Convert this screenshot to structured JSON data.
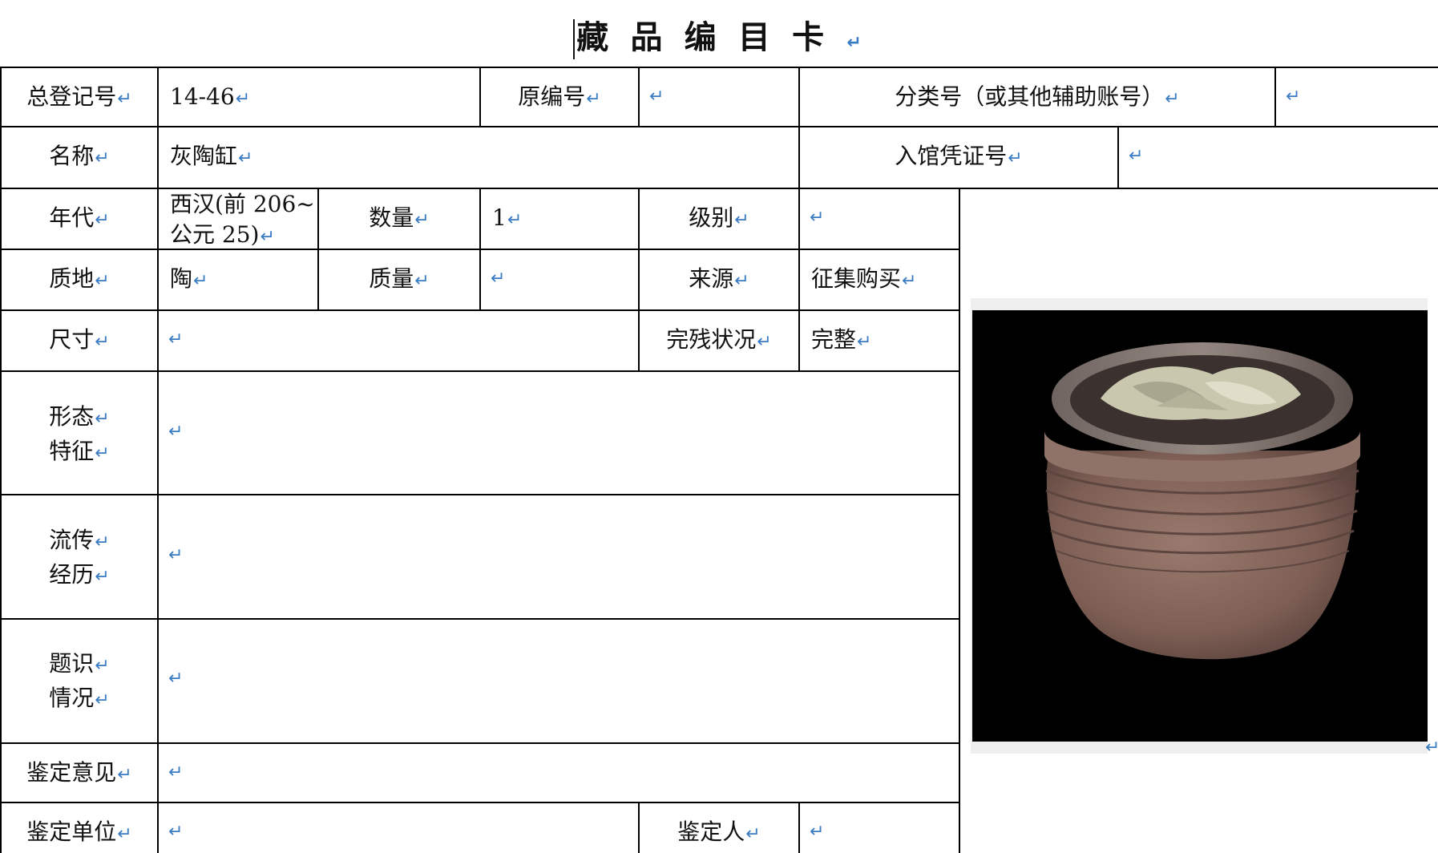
{
  "title": "藏品编目卡",
  "return_mark": "↵",
  "rows": {
    "registration_no_label": "总登记号",
    "registration_no_value": "14-46",
    "original_no_label": "原编号",
    "classification_label": "分类号（或其他辅助账号）",
    "name_label": "名称",
    "name_value": "灰陶缸",
    "entry_voucher_label": "入馆凭证号",
    "era_label": "年代",
    "era_value_line1": "西汉(前 206~",
    "era_value_line2": "公元 25)",
    "quantity_label": "数量",
    "quantity_value": "1",
    "grade_label": "级别",
    "material_label": "质地",
    "material_value": "陶",
    "weight_label": "质量",
    "source_label": "来源",
    "source_value": "征集购买",
    "size_label": "尺寸",
    "condition_label": "完残状况",
    "condition_value": "完整",
    "shape_label_1": "形态",
    "shape_label_2": "特征",
    "history_label_1": "流传",
    "history_label_2": "经历",
    "inscription_label_1": "题识",
    "inscription_label_2": "情况",
    "opinion_label": "鉴定意见",
    "unit_label": "鉴定单位",
    "appraiser_label": "鉴定人"
  },
  "photo": {
    "subject": "grey pottery jar",
    "background": "#000000",
    "pottery_color": "#8a6a60"
  }
}
